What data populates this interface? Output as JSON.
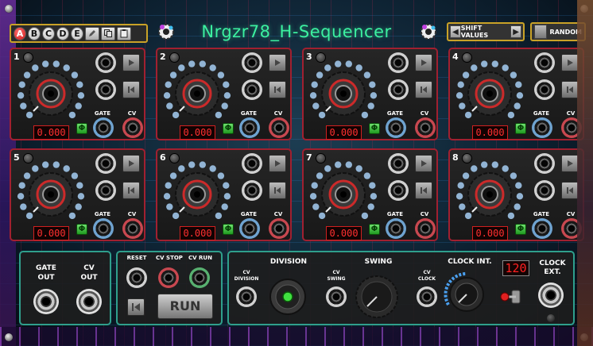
{
  "app": {
    "title": "Nrgzr78_H-Sequencer"
  },
  "header": {
    "letter_buttons": [
      {
        "label": "A",
        "active": true
      },
      {
        "label": "B",
        "active": false
      },
      {
        "label": "C",
        "active": false
      },
      {
        "label": "D",
        "active": false
      },
      {
        "label": "E",
        "active": false
      }
    ],
    "tool_icons": [
      "pencil-icon",
      "copy-icon",
      "paste-icon"
    ],
    "shift_values_label": "SHIFT VALUES",
    "random_label": "RANDOM"
  },
  "steps": [
    {
      "number": "1",
      "value": "0.000",
      "gate_label": "GATE",
      "cv_label": "CV",
      "phase_symbol": "Φ"
    },
    {
      "number": "2",
      "value": "0.000",
      "gate_label": "GATE",
      "cv_label": "CV",
      "phase_symbol": "Φ"
    },
    {
      "number": "3",
      "value": "0.000",
      "gate_label": "GATE",
      "cv_label": "CV",
      "phase_symbol": "Φ"
    },
    {
      "number": "4",
      "value": "0.000",
      "gate_label": "GATE",
      "cv_label": "CV",
      "phase_symbol": "Φ"
    },
    {
      "number": "5",
      "value": "0.000",
      "gate_label": "GATE",
      "cv_label": "CV",
      "phase_symbol": "Φ"
    },
    {
      "number": "6",
      "value": "0.000",
      "gate_label": "GATE",
      "cv_label": "CV",
      "phase_symbol": "Φ"
    },
    {
      "number": "7",
      "value": "0.000",
      "gate_label": "GATE",
      "cv_label": "CV",
      "phase_symbol": "Φ"
    },
    {
      "number": "8",
      "value": "0.000",
      "gate_label": "GATE",
      "cv_label": "CV",
      "phase_symbol": "Φ"
    }
  ],
  "outputs": {
    "gate_out": "GATE\nOUT",
    "cv_out": "CV\nOUT"
  },
  "transport": {
    "reset": "RESET",
    "cv_stop": "CV STOP",
    "cv_run": "CV RUN",
    "run_label": "RUN"
  },
  "clock": {
    "cv_division": "CV\nDIVISION",
    "division": "DIVISION",
    "cv_swing": "CV\nSWING",
    "swing": "SWING",
    "cv_clock": "CV\nCLOCK",
    "clock_int": "CLOCK INT.",
    "clock_ext": "CLOCK\nEXT.",
    "display_value": "120"
  },
  "colors": {
    "title": "#3cf0a0",
    "card_border": "#a12030",
    "bottom_border": "#2f9f8c",
    "accent": "#c9a227"
  }
}
